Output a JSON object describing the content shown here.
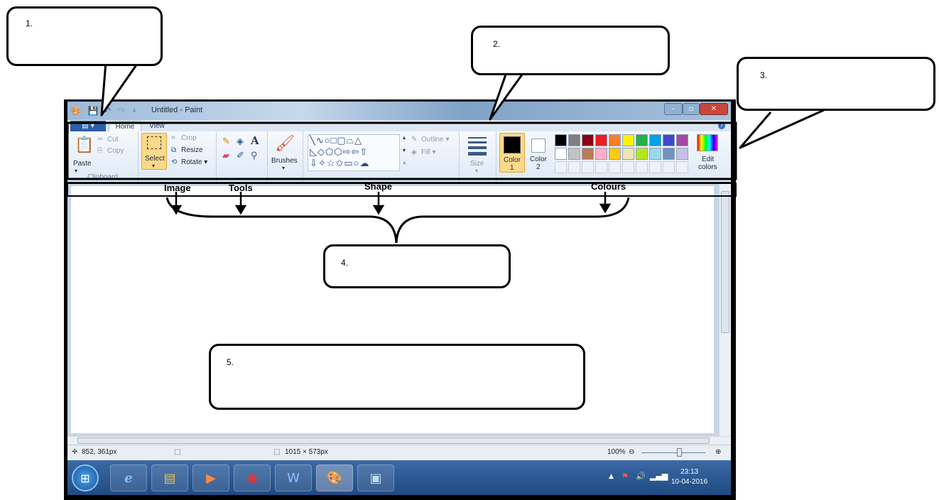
{
  "window": {
    "title": "Untitled - Paint",
    "menu_button": "▤ ▾",
    "tabs": [
      "Home",
      "View"
    ]
  },
  "ribbon": {
    "clipboard": {
      "paste": "Paste",
      "cut": "Cut",
      "copy": "Copy",
      "label": "Clipboard"
    },
    "image": {
      "select": "Select",
      "crop": "Crop",
      "resize": "Resize",
      "rotate": "Rotate ▾",
      "label": "Image"
    },
    "tools": {
      "label": "Tools"
    },
    "brushes": {
      "label": "Brushes"
    },
    "shapes": {
      "outline": "Outline ▾",
      "fill": "Fill ▾",
      "label": "Shape"
    },
    "size": {
      "label": "Size"
    },
    "colors": {
      "color1": "Color",
      "color1_num": "1",
      "color2": "Color",
      "color2_num": "2",
      "edit_colors": "Edit",
      "edit_colors_2": "colors",
      "label": "Colours",
      "palette_row1": [
        "#000000",
        "#7f7f7f",
        "#880015",
        "#ed1c24",
        "#ff7f27",
        "#fff200",
        "#22b14c",
        "#00a2e8",
        "#3f48cc",
        "#a349a4"
      ],
      "palette_row2": [
        "#ffffff",
        "#c3c3c3",
        "#b97a57",
        "#ffaec9",
        "#ffc90e",
        "#efe4b0",
        "#b5e61d",
        "#99d9ea",
        "#7092be",
        "#c8bfe7"
      ]
    }
  },
  "statusbar": {
    "cursor_pos": "852, 361px",
    "canvas_size": "1015 × 573px",
    "zoom": "100%"
  },
  "taskbar": {
    "time": "23:13",
    "date": "10-04-2016"
  },
  "annotations": {
    "c1": "1.",
    "c2": "2.",
    "c3": "3.",
    "c4": "4.",
    "c5": "5.",
    "image_label": "Image",
    "tools_label": "Tools",
    "shape_label": "Shape",
    "colours_label": "Colours"
  }
}
